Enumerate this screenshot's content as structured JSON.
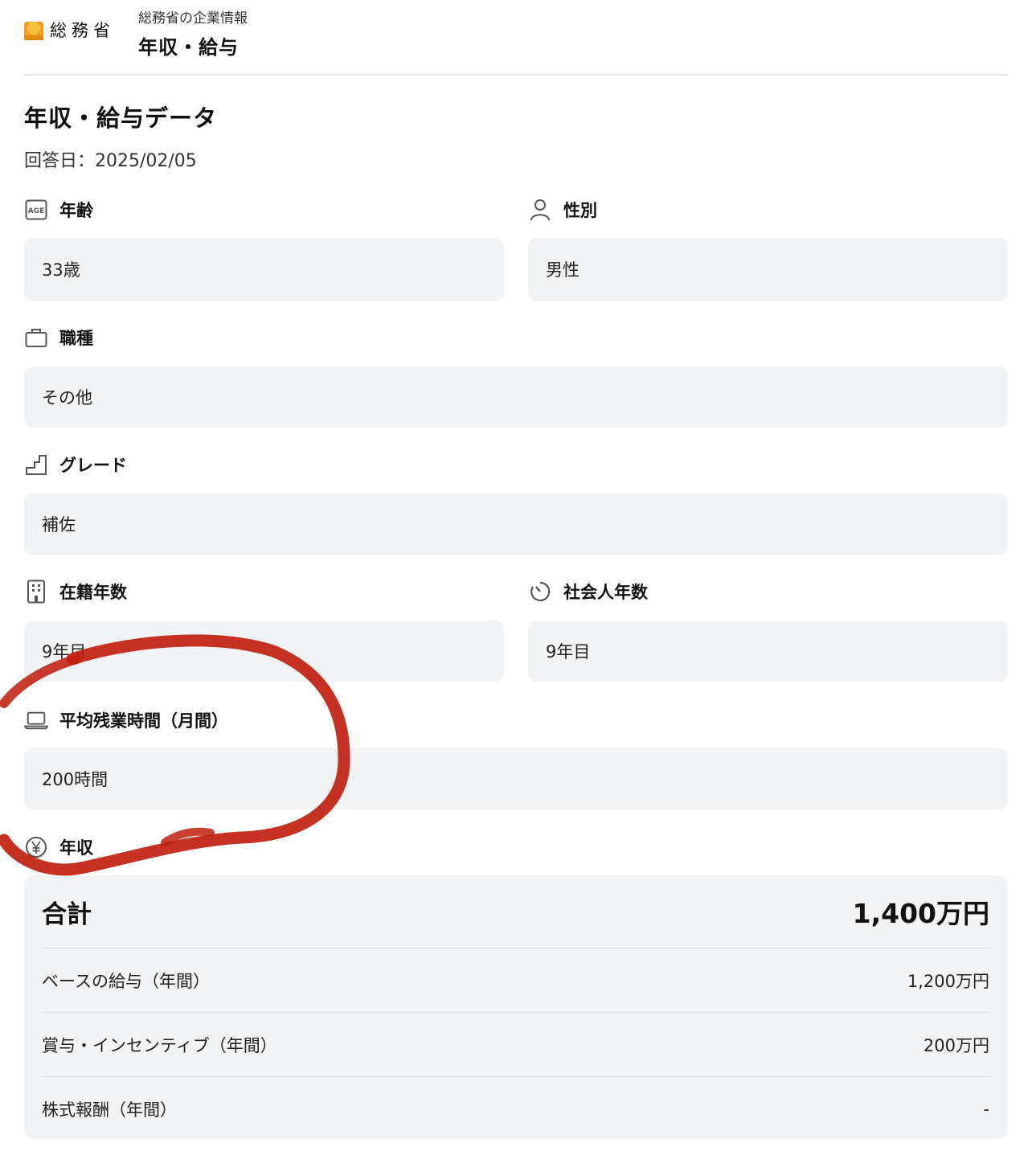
{
  "brand": {
    "name": "総務省",
    "icon": "logo-icon",
    "color": "#f0a020"
  },
  "breadcrumb": {
    "subtitle": "総務省の企業情報",
    "title": "年収・給与"
  },
  "page": {
    "title": "年収・給与データ",
    "answer_date": "回答日：2025/02/05"
  },
  "fields": {
    "age": {
      "label": "年齢",
      "value": "33歳",
      "icon": "age-icon"
    },
    "gender": {
      "label": "性別",
      "value": "男性",
      "icon": "person-icon"
    },
    "job": {
      "label": "職種",
      "value": "その他",
      "icon": "briefcase-icon"
    },
    "grade": {
      "label": "グレード",
      "value": "補佐",
      "icon": "stairs-icon"
    },
    "tenure": {
      "label": "在籍年数",
      "value": "9年目",
      "icon": "building-icon"
    },
    "career": {
      "label": "社会人年数",
      "value": "9年目",
      "icon": "timer-icon"
    },
    "overtime": {
      "label": "平均残業時間（月間）",
      "value": "200時間",
      "icon": "laptop-icon"
    },
    "income": {
      "label": "年収",
      "icon": "yen-icon"
    }
  },
  "income": {
    "total_label": "合計",
    "total_value": "1,400万円",
    "rows": [
      {
        "label": "ベースの給与（年間）",
        "value": "1,200万円"
      },
      {
        "label": "賞与・インセンティブ（年間）",
        "value": "200万円"
      },
      {
        "label": "株式報酬（年間）",
        "value": "-"
      }
    ]
  },
  "annotation": {
    "color": "#c0200f"
  }
}
